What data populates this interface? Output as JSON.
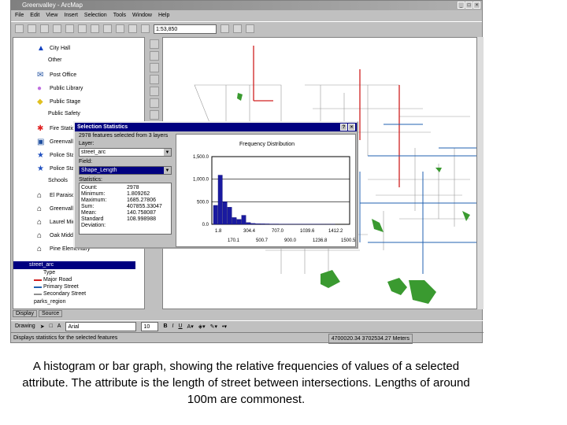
{
  "window": {
    "title": "Greenvalley - ArcMap"
  },
  "menu": [
    "File",
    "Edit",
    "View",
    "Insert",
    "Selection",
    "Tools",
    "Window",
    "Help"
  ],
  "toolbar": {
    "scale": "1:53,850"
  },
  "toc": {
    "items": [
      {
        "label": "City Hall",
        "icon": "triangle-icon",
        "color": "#1040c0"
      },
      {
        "label": "Other",
        "icon": "",
        "color": ""
      },
      {
        "label": "Post Office",
        "icon": "post-office-icon",
        "color": "#2050a0"
      },
      {
        "label": "Public Library",
        "icon": "circle-icon",
        "color": "#c070e0"
      },
      {
        "label": "Public Stage",
        "icon": "diamond-icon",
        "color": "#e0c020"
      },
      {
        "label": "Public Safety",
        "icon": "",
        "color": ""
      },
      {
        "label": "Fire Station",
        "icon": "asterisk-icon",
        "color": "#e02020"
      },
      {
        "label": "Greenvalley",
        "icon": "building-icon",
        "color": "#2050a0"
      },
      {
        "label": "Police Station",
        "icon": "star-icon",
        "color": "#2050c0"
      },
      {
        "label": "Police Station",
        "icon": "star-icon",
        "color": "#2050c0"
      },
      {
        "label": "Schools",
        "icon": "",
        "color": ""
      },
      {
        "label": "El Paraiso",
        "icon": "school-icon",
        "color": "#000"
      },
      {
        "label": "Greenvalley",
        "icon": "school-icon",
        "color": "#000"
      },
      {
        "label": "Laurel Middle",
        "icon": "school-icon",
        "color": "#000"
      },
      {
        "label": "Oak Middle",
        "icon": "school-icon",
        "color": "#000"
      },
      {
        "label": "Pine Elementary",
        "icon": "school-icon",
        "color": "#000"
      }
    ],
    "selected_layer": "street_arc",
    "legend_title": "Type",
    "legend": [
      {
        "label": "Major Road",
        "color": "#d02020"
      },
      {
        "label": "Primary Street",
        "color": "#2060b0"
      },
      {
        "label": "Secondary Street",
        "color": "#909090"
      }
    ],
    "next_layer": "parks_region"
  },
  "tabs": [
    "Display",
    "Source"
  ],
  "drawing": {
    "label": "Drawing",
    "font": "Arial",
    "size": "10"
  },
  "status": {
    "message": "Displays statistics for the selected features",
    "coords": "4700020.34  3702534.27 Meters"
  },
  "dialog": {
    "title": "Selection Statistics",
    "summary": "2978 features selected from 3 layers",
    "layer_label": "Layer:",
    "layer": "street_arc",
    "field_label": "Field:",
    "field": "Shape_Length",
    "stats_label": "Statistics:",
    "stats": [
      {
        "k": "Count:",
        "v": "2978"
      },
      {
        "k": "Minimum:",
        "v": "1.809262"
      },
      {
        "k": "Maximum:",
        "v": "1685.27806"
      },
      {
        "k": "Sum:",
        "v": "407855.33047"
      },
      {
        "k": "Mean:",
        "v": "140.758087"
      },
      {
        "k": "Standard Deviation:",
        "v": "108.998988"
      }
    ]
  },
  "chart_data": {
    "type": "bar",
    "title": "Frequency Distribution",
    "ylim": [
      0,
      1500
    ],
    "yticks": [
      "1,500.0",
      "1,000.0",
      "500.0",
      "0.0"
    ],
    "xticks_top": [
      "1.8",
      "304.4",
      "707.0",
      "1039.6",
      "1412.2"
    ],
    "xticks_bottom": [
      "170.1",
      "500.7",
      "900.0",
      "1236.8",
      "1500.5"
    ],
    "values": [
      420,
      1090,
      500,
      380,
      150,
      110,
      200,
      40,
      20,
      15,
      12,
      10,
      8,
      8,
      6,
      6,
      5,
      5,
      4,
      4,
      3,
      3,
      3,
      2,
      2,
      2
    ],
    "color": "#1a1aa0"
  },
  "caption": "A histogram or bar graph, showing the relative frequencies of values of a selected attribute. The attribute is the length of street between intersections. Lengths of around 100m are commonest."
}
